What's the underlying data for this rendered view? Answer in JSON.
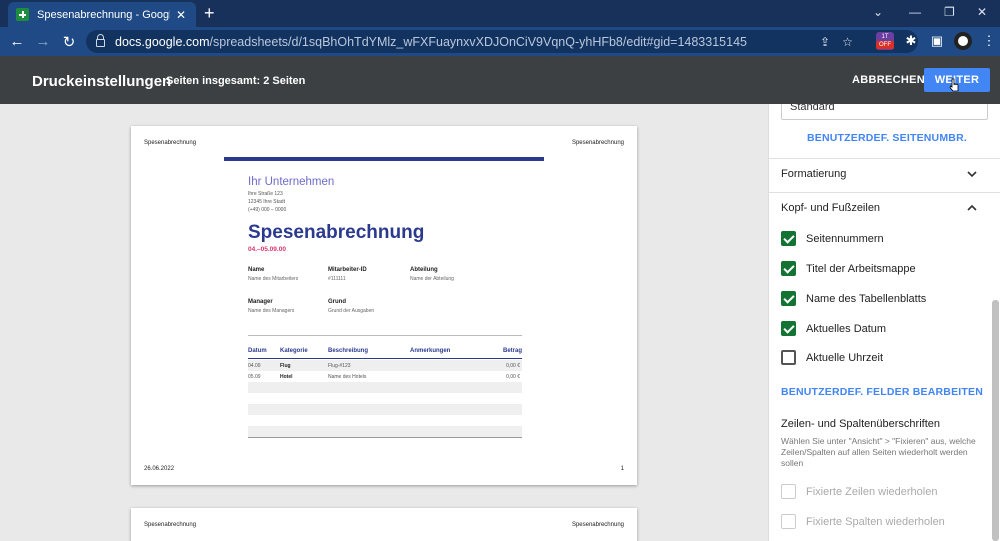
{
  "browser": {
    "tab_title": "Spesenabrechnung - Google Tabellen",
    "tab_close": "✕",
    "new_tab": "+",
    "url_host": "docs.google.com",
    "url_path": "/spreadsheets/d/1sqBhOhTdYMlz_wFXFuaynxvXDJOnCiV9VqnQ-yhHFb8/edit#gid=1483315145",
    "extension_badge_top": "1T",
    "extension_badge_bottom": "OFF"
  },
  "print": {
    "title": "Druckeinstellungen",
    "page_count_label": "Seiten insgesamt: 2 Seiten",
    "cancel_label": "ABBRECHEN",
    "next_label": "WEITER"
  },
  "preview": {
    "header_left": "Spesenabrechnung",
    "header_right": "Spesenabrechnung",
    "footer_date": "26.06.2022",
    "footer_page": "1",
    "company": "Ihr Unternehmen",
    "address_lines": [
      "Ihre Straße 123",
      "12345 Ihre Stadt",
      "(+49) 000 – 0000"
    ],
    "report_title": "Spesenabrechnung",
    "period": "04.–05.09.00",
    "fields": [
      {
        "label": "Name",
        "value": "Name des Mitarbeiters"
      },
      {
        "label": "Mitarbeiter-ID",
        "value": "#111111"
      },
      {
        "label": "Abteilung",
        "value": "Name der Abteilung"
      },
      {
        "label": "Manager",
        "value": "Name des Managers"
      },
      {
        "label": "Grund",
        "value": "Grund der Ausgaben"
      }
    ],
    "table_headers": [
      "Datum",
      "Kategorie",
      "Beschreibung",
      "Anmerkungen",
      "Betrag"
    ],
    "rows": [
      {
        "date": "04.09",
        "category": "Flug",
        "description": "Flug-#123",
        "note": "",
        "amount": "0,00 €"
      },
      {
        "date": "05.09",
        "category": "Hotel",
        "description": "Name des Hotels",
        "note": "",
        "amount": "0,00 €"
      }
    ]
  },
  "settings": {
    "select_value": "Standard",
    "custom_page_numbers": "BENUTZERDEF. SEITENUMBR.",
    "formatting_section": "Formatierung",
    "header_footer_section": "Kopf- und Fußzeilen",
    "checkboxes": [
      {
        "label": "Seitennummern",
        "checked": true
      },
      {
        "label": "Titel der Arbeitsmappe",
        "checked": true
      },
      {
        "label": "Name des Tabellenblatts",
        "checked": true
      },
      {
        "label": "Aktuelles Datum",
        "checked": true
      },
      {
        "label": "Aktuelle Uhrzeit",
        "checked": false
      }
    ],
    "edit_custom_fields": "BENUTZERDEF. FELDER BEARBEITEN",
    "row_col_heading": "Zeilen- und Spaltenüberschriften",
    "row_col_help": "Wählen Sie unter \"Ansicht\" > \"Fixieren\" aus, welche Zeilen/Spalten auf allen Seiten wiederholt werden sollen",
    "repeat_rows": "Fixierte Zeilen wiederholen",
    "repeat_cols": "Fixierte Spalten wiederholen"
  },
  "colors": {
    "accent_blue": "#4285f4",
    "checkbox_green": "#137333",
    "doc_navy": "#2b3a8f",
    "doc_purple": "#6d6ac9",
    "doc_pink": "#d6336c"
  }
}
